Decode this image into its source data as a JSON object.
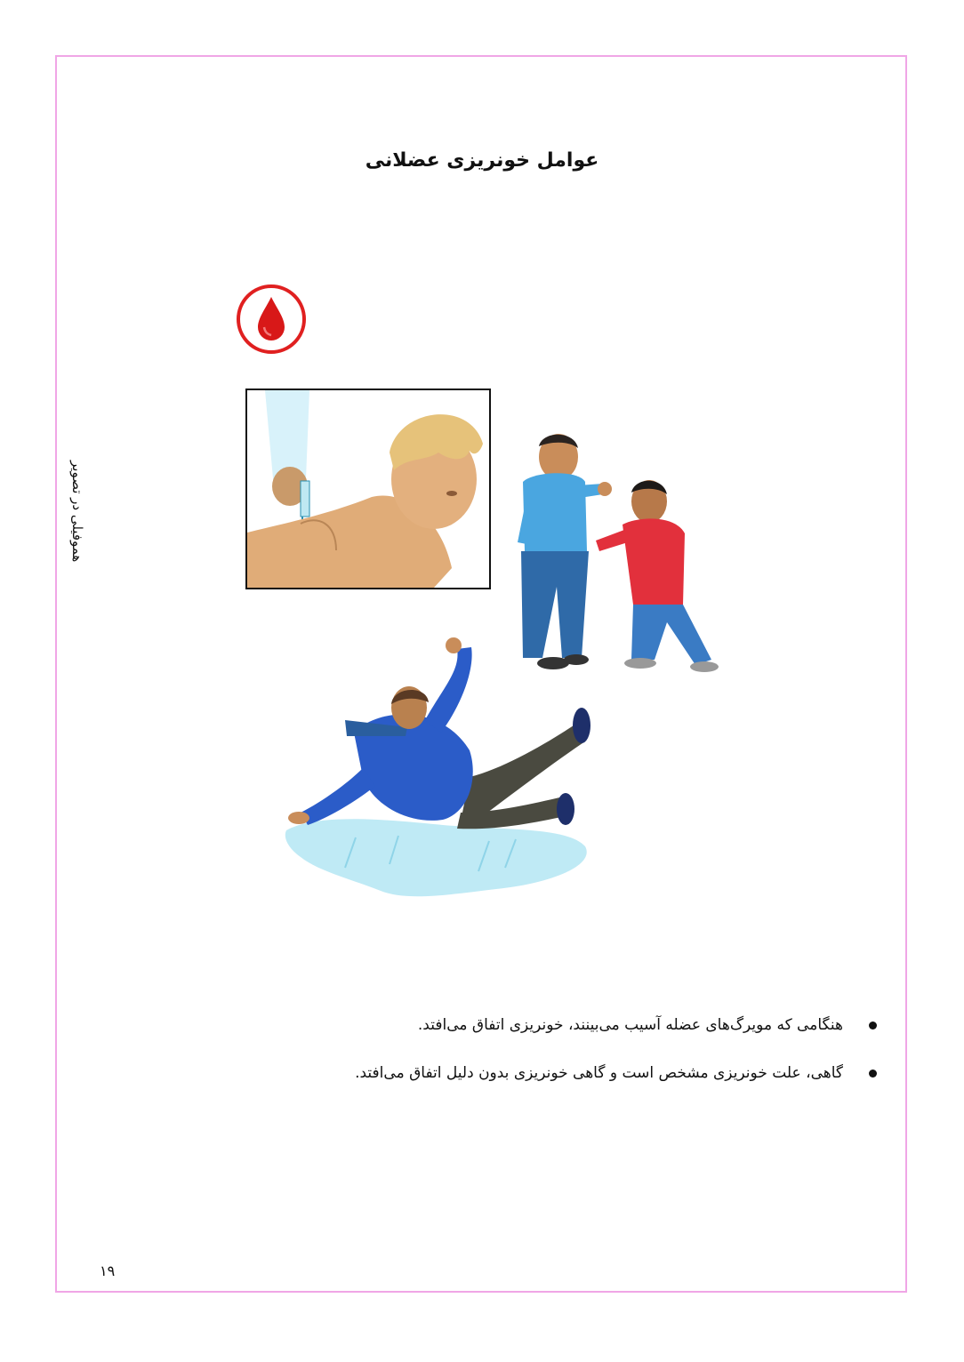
{
  "page": {
    "title": "عوامل خونریزی عضلانی",
    "side_label": "هموفیلی در تصویر",
    "page_number": "۱۹"
  },
  "bullets": [
    "هنگامی که مویرگ‌های عضله آسیب می‌بینند، خونریزی اتفاق می‌افتد.",
    "گاهی، علت خونریزی مشخص است و گاهی خونریزی بدون دلیل اتفاق می‌افتد."
  ],
  "colors": {
    "frame": "#f0a6e6",
    "blood_red": "#e02020"
  },
  "icons": [
    "blood-drop-icon"
  ]
}
